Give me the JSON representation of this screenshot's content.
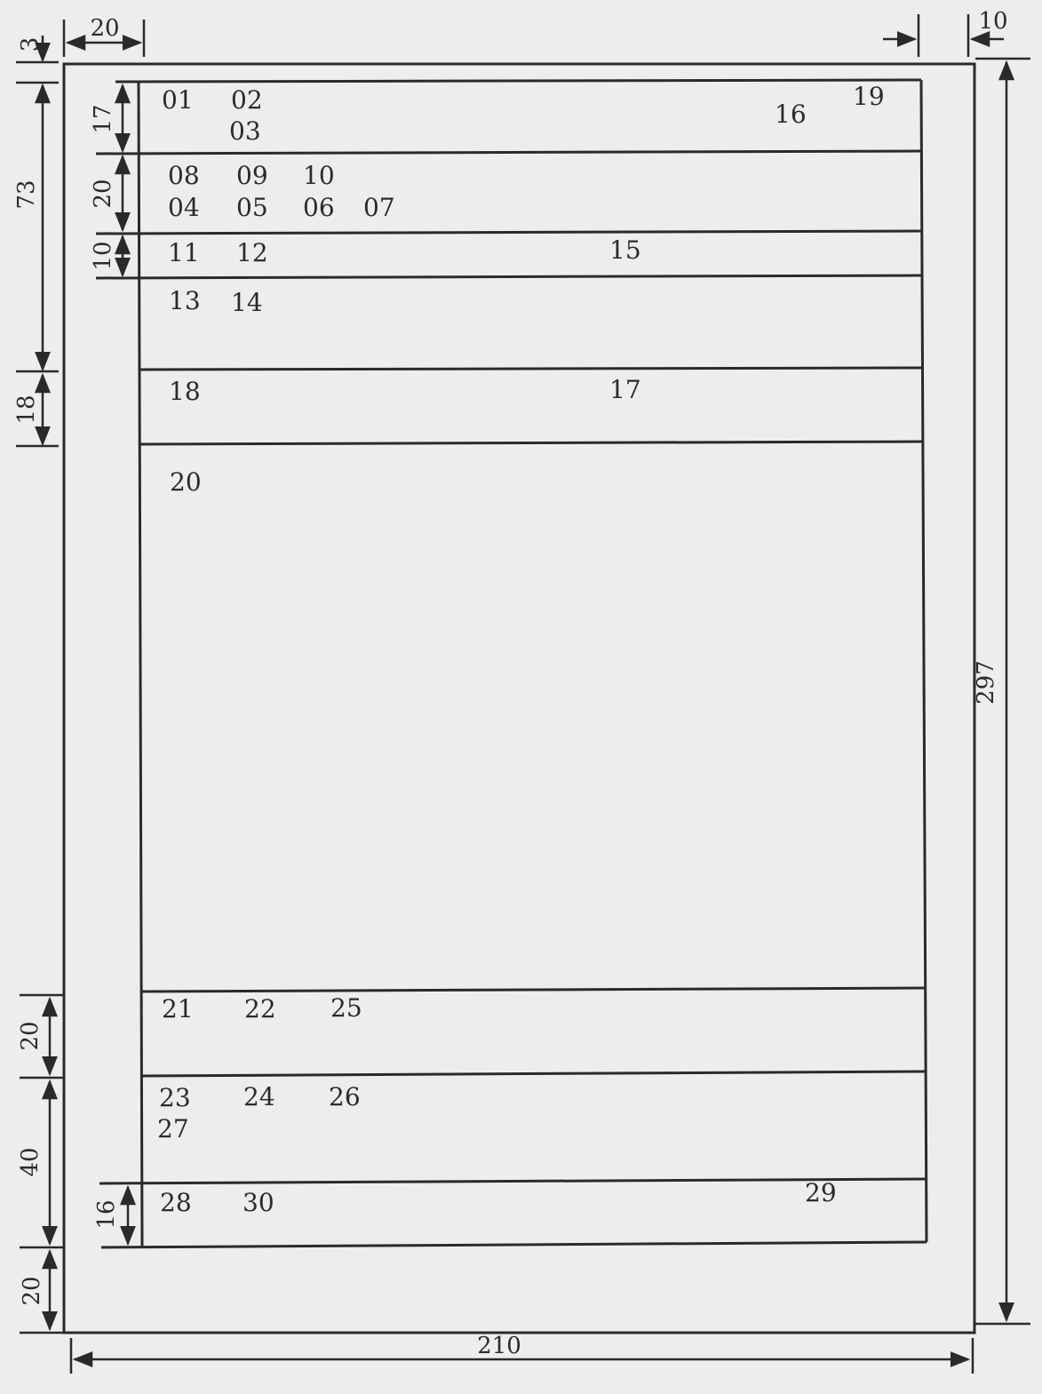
{
  "fields": {
    "f01": "01",
    "f02": "02",
    "f03": "03",
    "f04": "04",
    "f05": "05",
    "f06": "06",
    "f07": "07",
    "f08": "08",
    "f09": "09",
    "f10": "10",
    "f11": "11",
    "f12": "12",
    "f13": "13",
    "f14": "14",
    "f15": "15",
    "f16": "16",
    "f17": "17",
    "f18": "18",
    "f19": "19",
    "f20": "20",
    "f21": "21",
    "f22": "22",
    "f23": "23",
    "f24": "24",
    "f25": "25",
    "f26": "26",
    "f27": "27",
    "f28": "28",
    "f29": "29",
    "f30": "30"
  },
  "dimensions": {
    "top_margin": "3",
    "left_margin": "20",
    "right_margin": "10",
    "header_block": "73",
    "row_a": "17",
    "row_b": "20",
    "row_c": "10",
    "row_d": "18",
    "row_e": "20",
    "row_f": "40",
    "row_g": "16",
    "bottom_margin": "20",
    "page_width": "210",
    "page_height": "297"
  },
  "colors": {
    "line": "#2a2a2a",
    "paper": "#ededed"
  }
}
